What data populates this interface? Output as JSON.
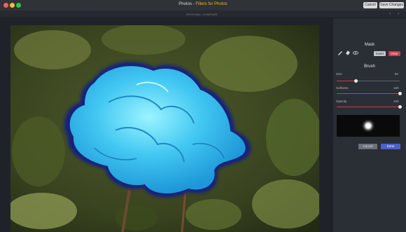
{
  "window": {
    "app_title": "Photos",
    "separator": " - ",
    "extension_title": "Filters for Photos",
    "cancel_label": "Cancel",
    "save_label": "Save Changes"
  },
  "toolbar": {
    "original_label": "ORIGINAL",
    "compare_label": "COMPARE",
    "prev_icon": "chevron-left-icon",
    "next_icon": "chevron-right-icon"
  },
  "panel": {
    "mask_heading": "Mask",
    "tools": [
      "brush-tool-icon",
      "eraser-tool-icon",
      "visibility-toggle-icon"
    ],
    "invert_label": "Invert",
    "clear_label": "Clear",
    "brush_heading": "Brush",
    "sliders": [
      {
        "label": "Size",
        "value": "60",
        "fraction": 0.3
      },
      {
        "label": "Softness",
        "value": "100",
        "fraction": 1.0
      },
      {
        "label": "Opacity",
        "value": "100",
        "fraction": 1.0
      }
    ],
    "cancel_label": "Cancel",
    "done_label": "Done"
  },
  "colors": {
    "accent_red": "#d03a4a",
    "done_blue": "#4a62c9",
    "title_yellow": "#f0b327",
    "close": "#fc5f57",
    "minimize": "#fdbc2e",
    "maximize": "#28c840"
  }
}
